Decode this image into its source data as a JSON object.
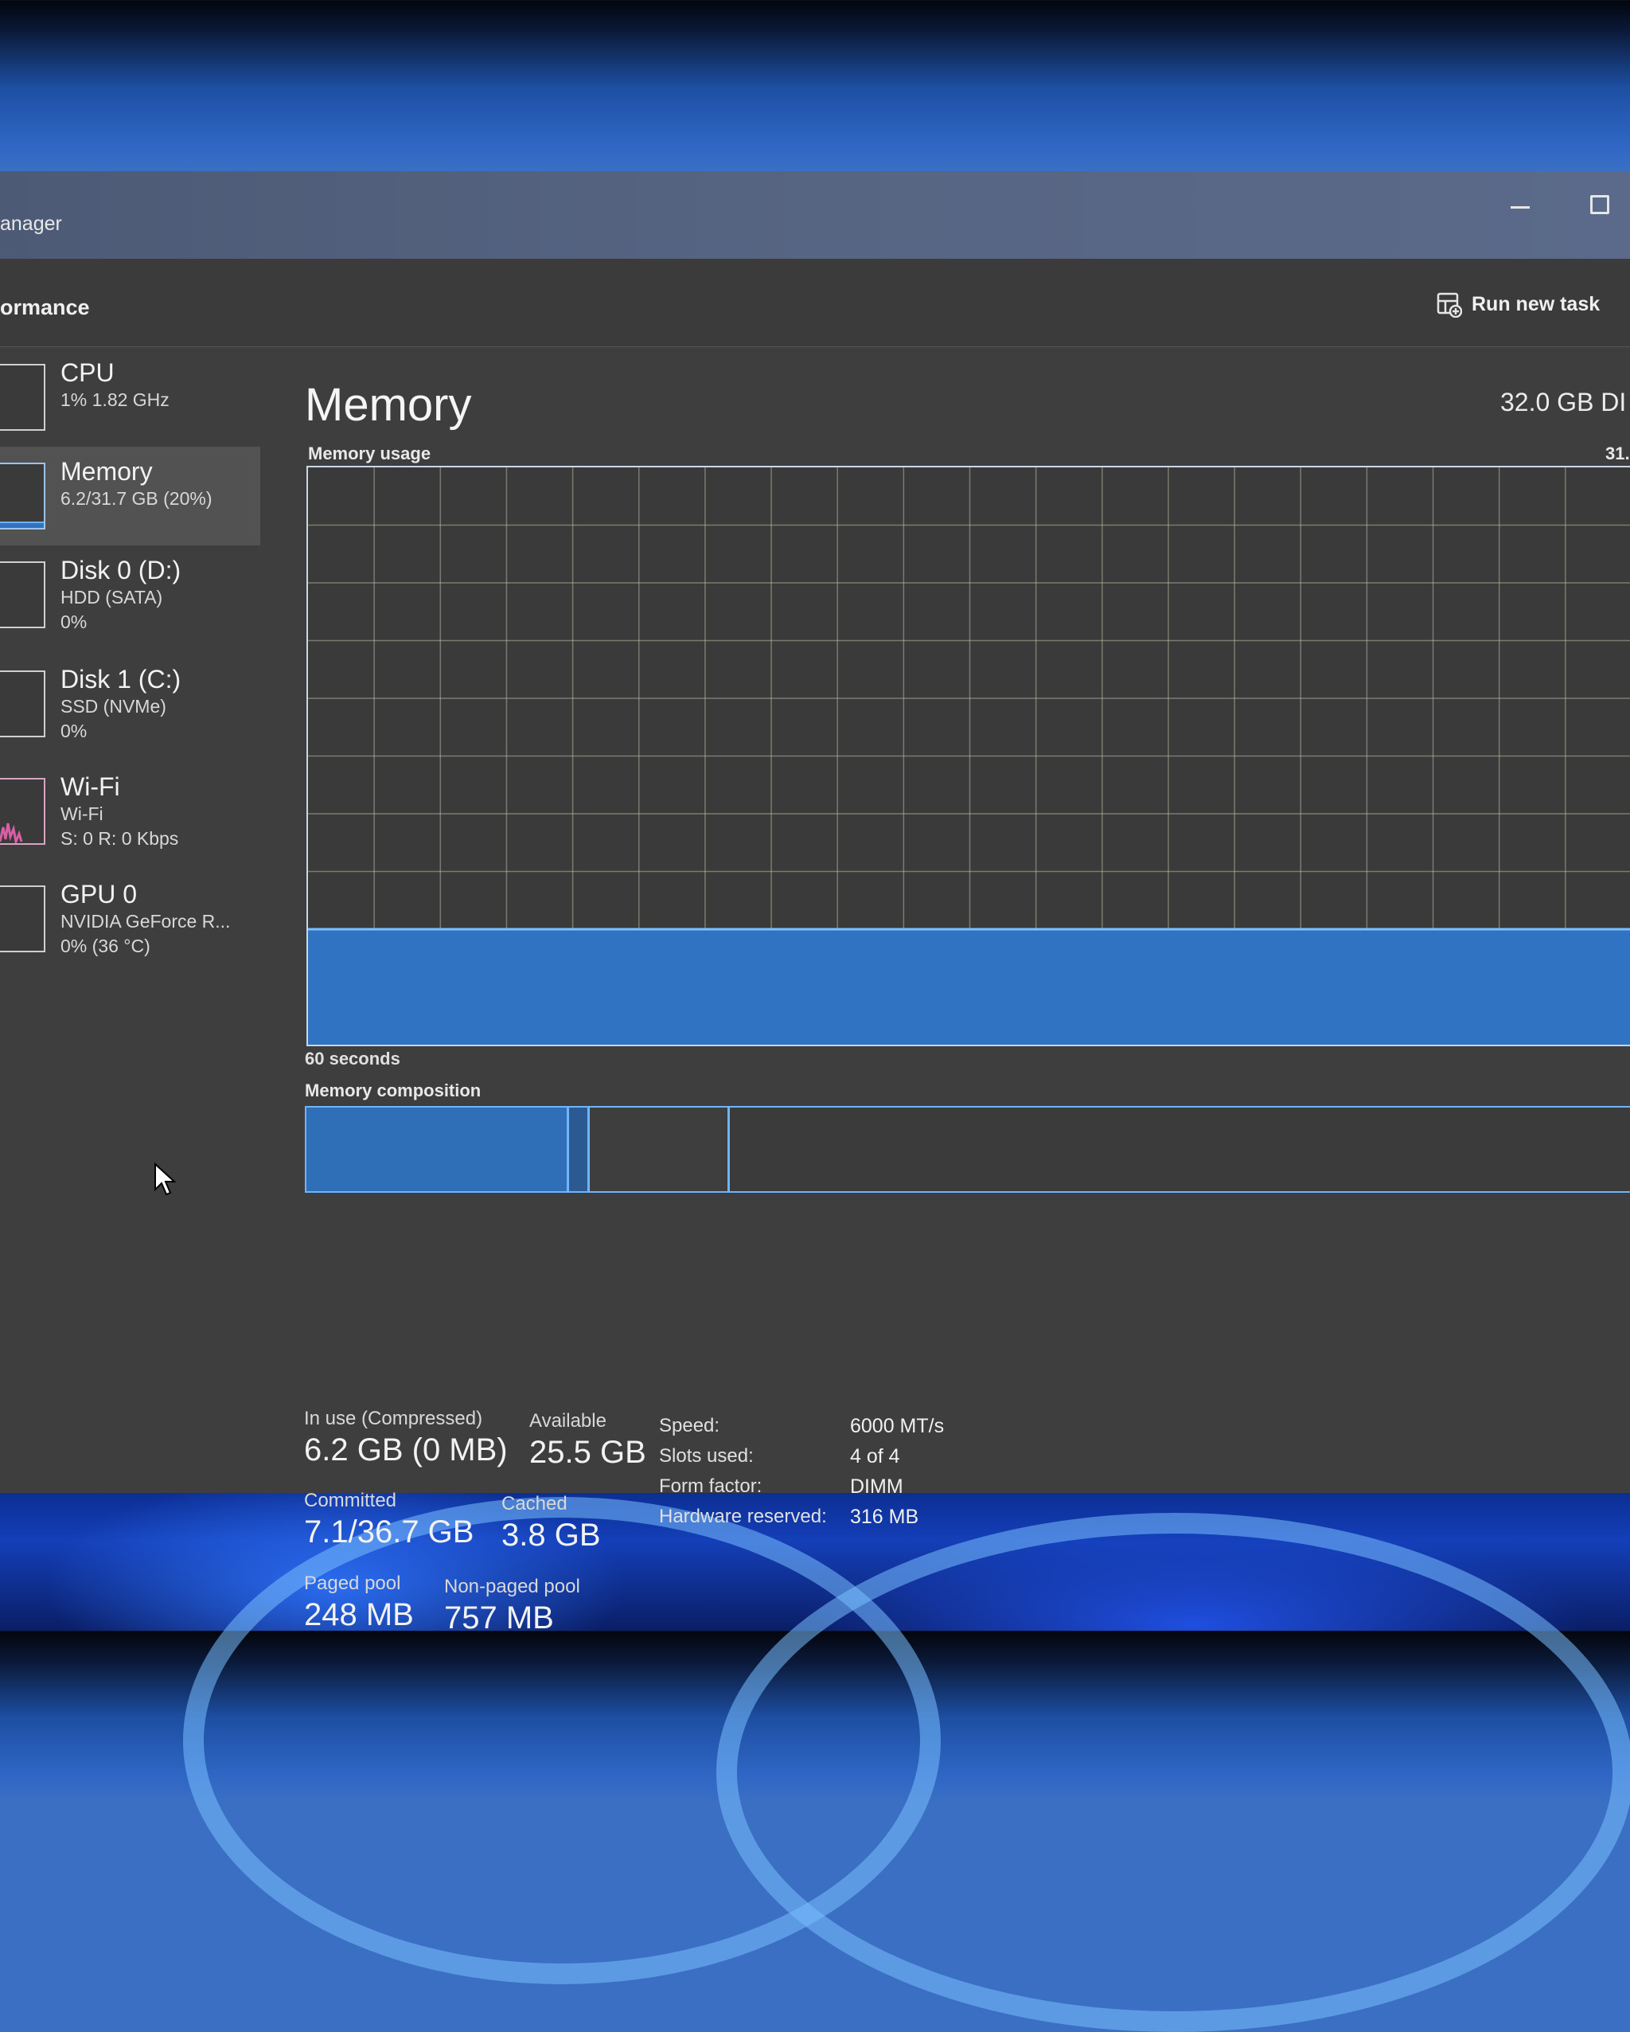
{
  "window": {
    "title": "anager"
  },
  "command_bar": {
    "page_title": "ormance",
    "run_new_task": "Run new task"
  },
  "sidebar": {
    "items": [
      {
        "name": "CPU",
        "sub1": "1%  1.82 GHz",
        "sub2": ""
      },
      {
        "name": "Memory",
        "sub1": "6.2/31.7 GB (20%)",
        "sub2": ""
      },
      {
        "name": "Disk 0 (D:)",
        "sub1": "HDD (SATA)",
        "sub2": "0%"
      },
      {
        "name": "Disk 1 (C:)",
        "sub1": "SSD (NVMe)",
        "sub2": "0%"
      },
      {
        "name": "Wi-Fi",
        "sub1": "Wi-Fi",
        "sub2": "S: 0 R: 0 Kbps"
      },
      {
        "name": "GPU 0",
        "sub1": "NVIDIA GeForce R...",
        "sub2": "0% (36 °C)"
      }
    ]
  },
  "main": {
    "title": "Memory",
    "memory_type": "32.0 GB DI",
    "usage_label": "Memory usage",
    "usage_max": "31.",
    "axis_label": "60 seconds",
    "usage_fraction": 0.2,
    "composition_label": "Memory composition",
    "stats": {
      "in_use_label": "In use (Compressed)",
      "in_use_value": "6.2 GB (0 MB)",
      "available_label": "Available",
      "available_value": "25.5 GB",
      "committed_label": "Committed",
      "committed_value": "7.1/36.7 GB",
      "cached_label": "Cached",
      "cached_value": "3.8 GB",
      "paged_label": "Paged pool",
      "paged_value": "248 MB",
      "nonpaged_label": "Non-paged pool",
      "nonpaged_value": "757 MB"
    },
    "specs": [
      {
        "key": "Speed:",
        "value": "6000 MT/s"
      },
      {
        "key": "Slots used:",
        "value": "4 of 4"
      },
      {
        "key": "Form factor:",
        "value": "DIMM"
      },
      {
        "key": "Hardware reserved:",
        "value": "316 MB"
      }
    ]
  },
  "colors": {
    "accent": "#2f73c2",
    "accent_line": "#6fb4ff",
    "background": "#3e3e3e"
  }
}
